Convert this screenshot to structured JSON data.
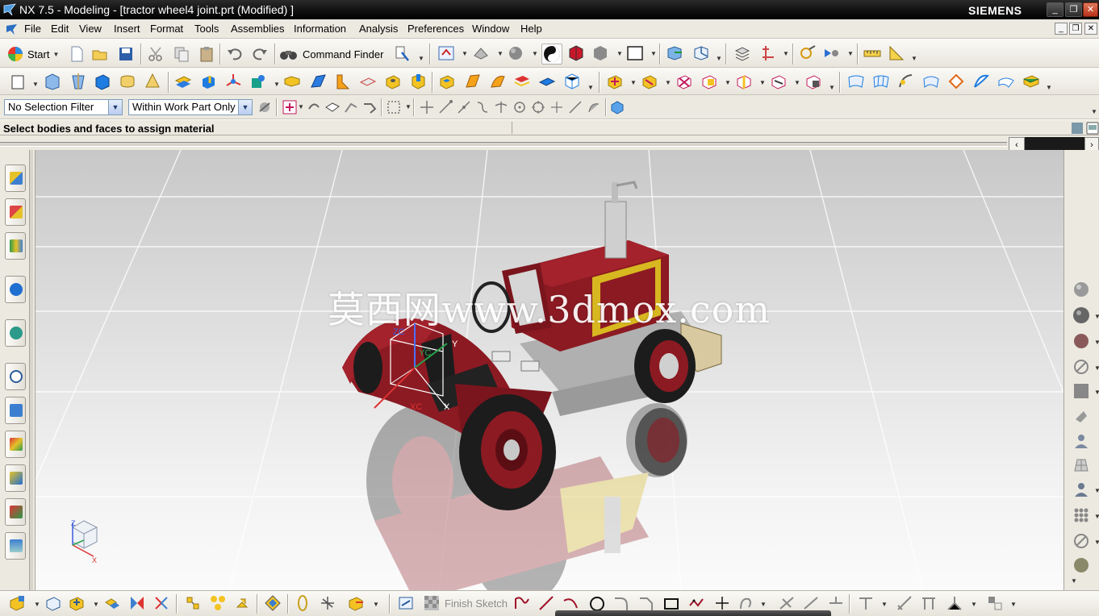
{
  "window": {
    "title": "NX 7.5 - Modeling - [tractor wheel4 joint.prt (Modified) ]",
    "brand": "SIEMENS",
    "minimize_glyph": "_",
    "maximize_glyph": "❐",
    "close_glyph": "✕"
  },
  "menu": {
    "items": [
      "File",
      "Edit",
      "View",
      "Insert",
      "Format",
      "Tools",
      "Assemblies",
      "Information",
      "Analysis",
      "Preferences",
      "Window",
      "Help"
    ],
    "mdi_minimize": "_",
    "mdi_restore": "❐",
    "mdi_close": "✕"
  },
  "toolbar": {
    "start_label": "Start",
    "command_finder_label": "Command Finder"
  },
  "selection": {
    "filter_value": "No Selection Filter",
    "scope_value": "Within Work Part Only"
  },
  "cue_line": "Select bodies and faces to assign material",
  "scroll": {
    "left_glyph": "‹",
    "right_glyph": "›"
  },
  "viewport": {
    "watermark": "莫西网www.3dmox.com",
    "wcs_labels": {
      "zc": "ZC",
      "yc": "YC",
      "xc": "XC",
      "x": "X",
      "y": "Y"
    },
    "triad_labels": {
      "z": "Z",
      "x": "X"
    }
  },
  "sketch": {
    "finish_label": "Finish Sketch"
  },
  "colors": {
    "tractor_body": "#8c1a22",
    "tractor_trim": "#d8b820",
    "tire": "#1c1c1c",
    "rim": "#8c1a22",
    "grid": "#ffffff"
  }
}
